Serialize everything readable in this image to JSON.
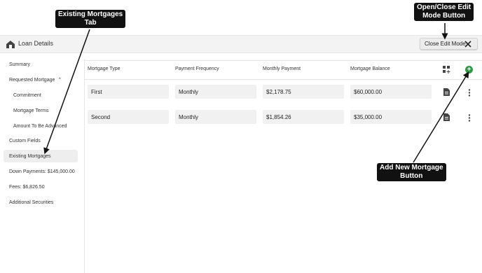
{
  "header": {
    "title": "Loan Details",
    "close_edit_label": "Close Edit Mode"
  },
  "sidebar": {
    "items": [
      {
        "label": "Summary"
      },
      {
        "label": "Requested Mortgage"
      },
      {
        "label": "Commitment"
      },
      {
        "label": "Mortgage Terms"
      },
      {
        "label": "Amount To Be Advanced"
      },
      {
        "label": "Custom Fields"
      },
      {
        "label": "Existing Mortgages"
      },
      {
        "label": "Down Payments: $145,000.00"
      },
      {
        "label": "Fees: $6,826.50"
      },
      {
        "label": "Additional Securities"
      }
    ]
  },
  "table": {
    "columns": [
      "Mortgage Type",
      "Payment Frequency",
      "Monthly Payment",
      "Mortgage Balance"
    ],
    "rows": [
      {
        "type": "First",
        "frequency": "Monthly",
        "payment": "$2,178.75",
        "balance": "$60,000.00"
      },
      {
        "type": "Second",
        "frequency": "Monthly",
        "payment": "$1,854.26",
        "balance": "$35,000.00"
      }
    ]
  },
  "callouts": {
    "existing_tab": "Existing Mortgages Tab",
    "existing_tab_line1": "Existing Mortgages",
    "existing_tab_line2": "Tab",
    "edit_mode_line1": "Open/Close Edit",
    "edit_mode_line2": "Mode Button",
    "add_new_line1": "Add New Mortgage",
    "add_new_line2": "Button"
  },
  "colors": {
    "add_button": "#2e9b45",
    "callout_bg": "#111111"
  },
  "icons": {
    "header": "house-dollar-icon",
    "edit_mode": "tools-icon",
    "grid": "grid-add-icon",
    "add": "plus-circle-icon",
    "document": "document-icon",
    "more": "kebab-menu-icon"
  }
}
